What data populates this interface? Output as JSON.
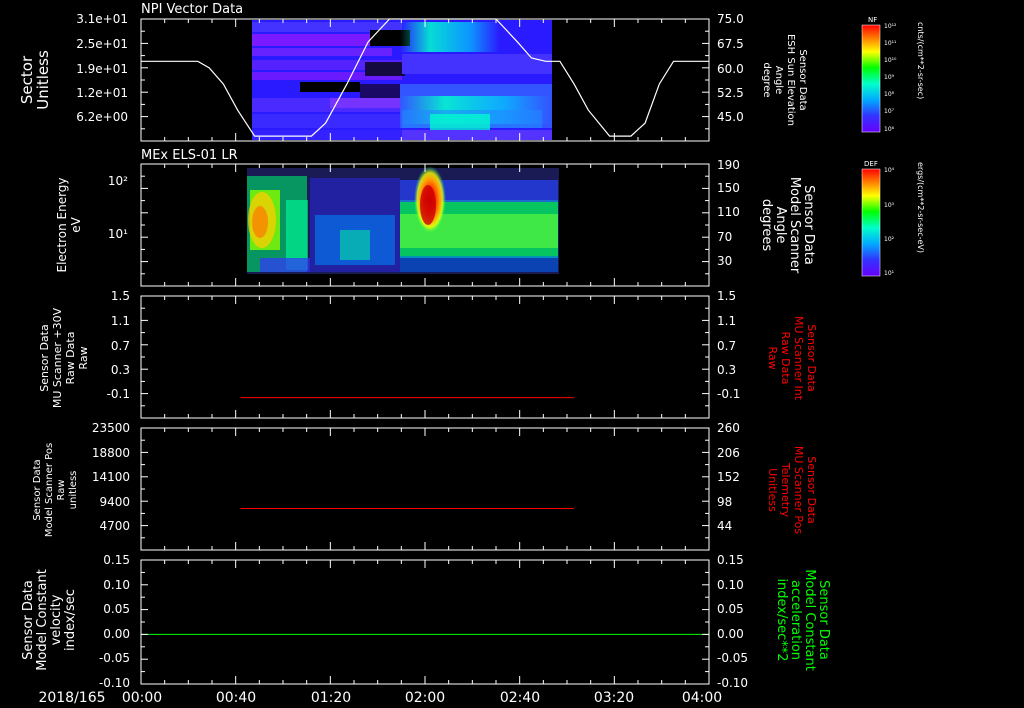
{
  "figure": {
    "date_label": "2018/165",
    "time_ticks": [
      "00:00",
      "00:40",
      "01:20",
      "02:00",
      "02:40",
      "03:20",
      "04:00"
    ]
  },
  "colorbars": [
    {
      "title": "NF",
      "top_label": "10¹²",
      "bottom_label": "10⁶",
      "labels": [
        "10¹²",
        "10¹¹",
        "10¹⁰",
        "10⁹",
        "10⁸",
        "10⁷",
        "10⁶"
      ],
      "units": "cnts/(cm**2-sr-sec)"
    },
    {
      "title": "DEF",
      "top_label": "10⁴",
      "bottom_label": "10¹",
      "labels": [
        "10⁴",
        "10³",
        "10²",
        "10¹"
      ],
      "units": "ergs/(cm**2-sr-sec-eV)"
    }
  ],
  "chart_data": [
    {
      "type": "heatmap",
      "title": "NPI Vector Data",
      "ylabel": [
        "Sector",
        "Unitless"
      ],
      "yticks": [
        "3.1e+01",
        "2.5e+01",
        "1.9e+01",
        "1.2e+01",
        "6.2e+00"
      ],
      "ylim": [
        0,
        31
      ],
      "y2label": [
        "Sensor Data",
        "ESH Sun Elevation",
        "Angle",
        "degree"
      ],
      "y2ticks": [
        "75.0",
        "67.5",
        "60.0",
        "52.5",
        "45.0"
      ],
      "y2lim": [
        37.5,
        75
      ],
      "data_time_range_hours": [
        0.81,
        2.75
      ],
      "overlay_line": {
        "name": "ESH Sun Elevation Angle",
        "color": "#ffffff",
        "x_hours": [
          0.0,
          0.4,
          0.48,
          0.58,
          0.68,
          0.8,
          1.2,
          1.3,
          1.45,
          1.6,
          1.75,
          1.95,
          2.3,
          2.5,
          2.65,
          2.75,
          2.85,
          2.95,
          3.05,
          3.15,
          3.3,
          3.45,
          3.55,
          3.65,
          3.75,
          3.85,
          4.0
        ],
        "y": [
          62,
          62,
          60,
          55,
          47,
          39,
          39,
          43,
          55,
          68,
          75,
          75,
          75,
          75,
          68,
          63,
          62,
          62,
          55,
          47,
          39,
          39,
          43,
          55,
          62,
          62,
          62
        ]
      }
    },
    {
      "type": "heatmap",
      "title": "MEx ELS-01 LR",
      "ylabel": [
        "Electron Energy",
        "eV"
      ],
      "yticks": [
        "10²",
        "10¹"
      ],
      "ylog": true,
      "y2label": [
        "Sensor Data",
        "Model Scanner",
        "Angle",
        "degrees"
      ],
      "y2ticks": [
        "190",
        "150",
        "110",
        "70",
        "30"
      ],
      "y2lim": [
        10,
        190
      ],
      "data_time_range_hours": [
        0.78,
        2.9
      ],
      "overlay_line": {
        "name": "Model Scanner Angle",
        "color": "#ffffff",
        "y": 10
      }
    },
    {
      "type": "line",
      "ylabel": [
        "Sensor Data",
        "MU Scanner +30V",
        "Raw Data",
        "Raw"
      ],
      "yticks": [
        "1.5",
        "1.1",
        "0.7",
        "0.3",
        "-0.1"
      ],
      "ylim": [
        -0.3,
        1.5
      ],
      "y2label": [
        "Sensor Data",
        "MU Scanner Int",
        "Raw Data",
        "Raw"
      ],
      "y2ticks": [
        "1.5",
        "1.1",
        "0.7",
        "0.3",
        "-0.1"
      ],
      "y2_color": "#ff0000",
      "series": [
        {
          "name": "MU Scanner Int Raw Data",
          "color": "#ff0000",
          "x_hours": [
            0.7,
            3.05
          ],
          "y": [
            0,
            0
          ]
        }
      ]
    },
    {
      "type": "line",
      "ylabel": [
        "Sensor Data",
        "Model Scanner Pos",
        "Raw",
        "unitless"
      ],
      "yticks": [
        "23500",
        "18800",
        "14100",
        "9400",
        "4700"
      ],
      "ylim": [
        0,
        23500
      ],
      "y2label": [
        "Sensor Data",
        "MU Scanner Pos",
        "Telemetry",
        "Unitless"
      ],
      "y2ticks": [
        "260",
        "206",
        "152",
        "98",
        "44"
      ],
      "y2_color": "#ff0000",
      "series": [
        {
          "name": "MU Scanner Pos Telemetry",
          "color": "#ff0000",
          "x_hours": [
            0.7,
            3.05
          ],
          "y": [
            8000,
            8000
          ]
        }
      ]
    },
    {
      "type": "line",
      "ylabel": [
        "Sensor Data",
        "Model Constant",
        "velocity",
        "index/sec"
      ],
      "yticks": [
        "0.15",
        "0.10",
        "0.05",
        "0.00",
        "-0.05",
        "-0.10"
      ],
      "ylim": [
        -0.1,
        0.15
      ],
      "y2label": [
        "Sensor Data",
        "Model Constant",
        "acceleration",
        "index/sec**2"
      ],
      "y2ticks": [
        "0.15",
        "0.10",
        "0.05",
        "0.00",
        "-0.05",
        "-0.10"
      ],
      "y2_color": "#00ff00",
      "series": [
        {
          "name": "Model Constant acceleration",
          "color": "#00ff00",
          "x_hours": [
            0,
            4
          ],
          "y": [
            0,
            0
          ]
        }
      ]
    }
  ]
}
